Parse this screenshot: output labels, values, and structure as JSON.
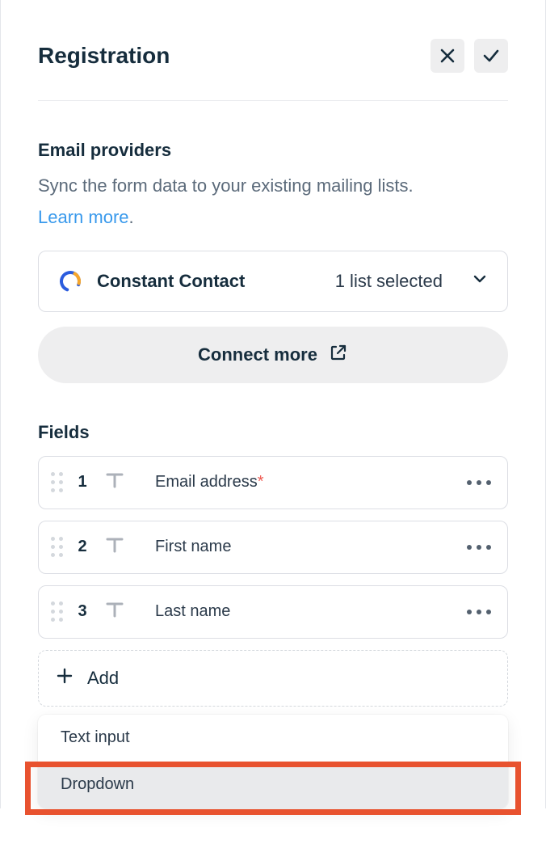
{
  "header": {
    "title": "Registration"
  },
  "emailProviders": {
    "title": "Email providers",
    "description": "Sync the form data to your existing mailing lists.",
    "learnMoreLabel": "Learn more",
    "provider": {
      "name": "Constant Contact",
      "status": "1 list selected"
    },
    "connectMoreLabel": "Connect more"
  },
  "fieldsSection": {
    "title": "Fields",
    "fields": [
      {
        "num": "1",
        "label": "Email address",
        "required": true
      },
      {
        "num": "2",
        "label": "First name",
        "required": false
      },
      {
        "num": "3",
        "label": "Last name",
        "required": false
      }
    ],
    "addLabel": "Add"
  },
  "addMenu": {
    "options": [
      {
        "label": "Text input",
        "selected": false
      },
      {
        "label": "Dropdown",
        "selected": true
      }
    ]
  }
}
